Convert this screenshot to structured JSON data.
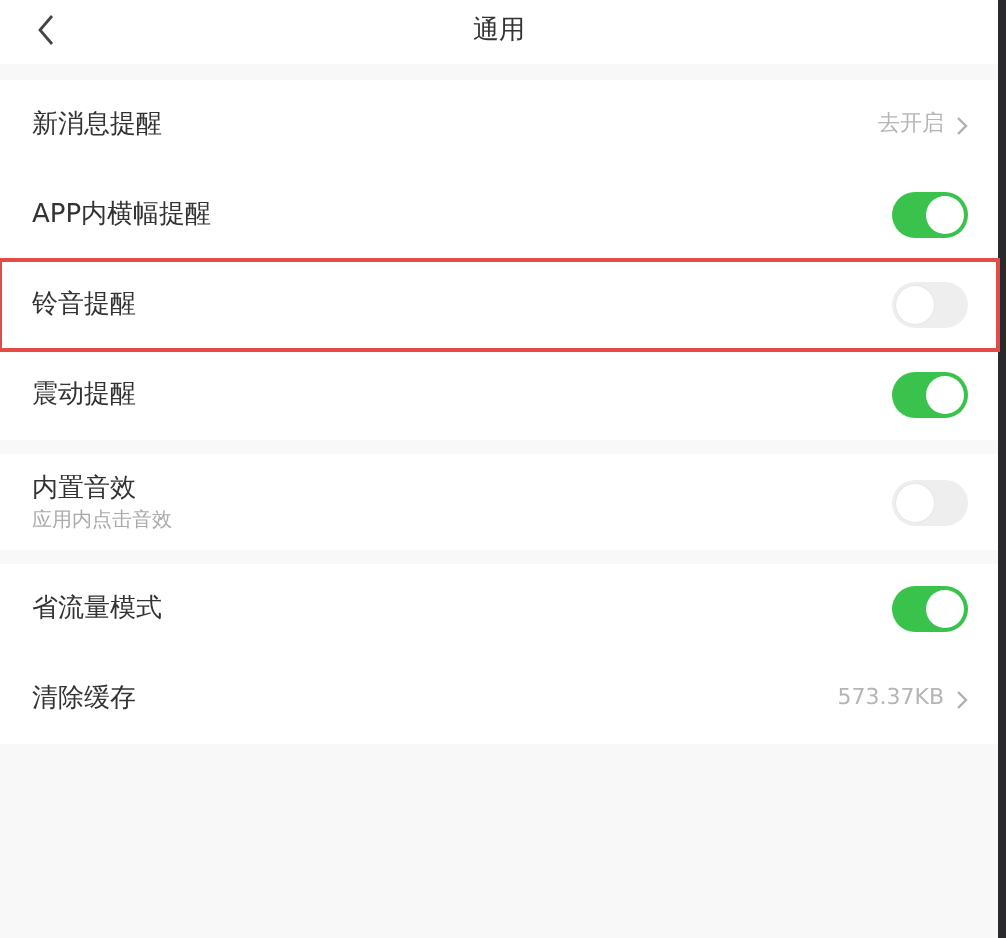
{
  "header": {
    "title": "通用"
  },
  "groups": [
    {
      "items": [
        {
          "kind": "link",
          "label": "新消息提醒",
          "value": "去开启",
          "highlighted": false
        },
        {
          "kind": "toggle",
          "label": "APP内横幅提醒",
          "on": true,
          "highlighted": false
        },
        {
          "kind": "toggle",
          "label": "铃音提醒",
          "on": false,
          "highlighted": true
        },
        {
          "kind": "toggle",
          "label": "震动提醒",
          "on": true,
          "highlighted": false
        }
      ]
    },
    {
      "items": [
        {
          "kind": "toggle",
          "label": "内置音效",
          "subtitle": "应用内点击音效",
          "on": false,
          "highlighted": false
        }
      ]
    },
    {
      "items": [
        {
          "kind": "toggle",
          "label": "省流量模式",
          "on": true,
          "highlighted": false
        },
        {
          "kind": "link",
          "label": "清除缓存",
          "value": "573.37KB",
          "highlighted": false
        }
      ]
    }
  ]
}
